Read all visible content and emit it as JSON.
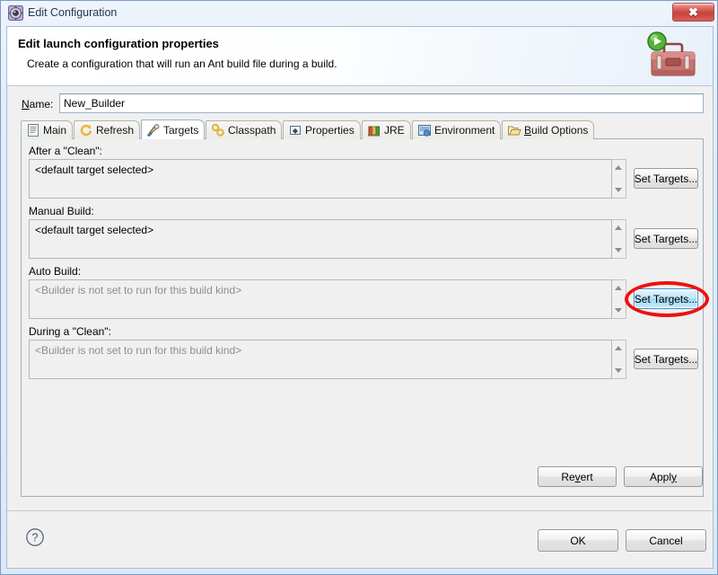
{
  "window": {
    "title": "Edit Configuration",
    "icon": "config-gear-icon",
    "close_label": "✖"
  },
  "header": {
    "title": "Edit launch configuration properties",
    "subtitle": "Create a configuration that will run an Ant build file during a build.",
    "art_icon": "toolbox-with-run-badge-icon"
  },
  "name_row": {
    "label_pre": "",
    "label_accel": "N",
    "label_post": "ame:",
    "value": "New_Builder",
    "placeholder": "Enter configuration name"
  },
  "tabs": [
    {
      "label": "Main",
      "icon": "document-icon",
      "active": false,
      "accel": ""
    },
    {
      "label": "Refresh",
      "icon": "refresh-icon",
      "active": false,
      "accel": ""
    },
    {
      "label": "Targets",
      "icon": "targets-icon",
      "active": true,
      "accel": ""
    },
    {
      "label": "Classpath",
      "icon": "classpath-icon",
      "active": false,
      "accel": ""
    },
    {
      "label": "Properties",
      "icon": "properties-icon",
      "active": false,
      "accel": ""
    },
    {
      "label": "JRE",
      "icon": "jre-icon",
      "active": false,
      "accel": ""
    },
    {
      "label": "Environment",
      "icon": "environment-icon",
      "active": false,
      "accel": ""
    },
    {
      "label": "Build Options",
      "icon": "folder-icon",
      "active": false,
      "accel": "B"
    }
  ],
  "targets": {
    "groups": [
      {
        "label": "After a \"Clean\":",
        "value": "<default target selected>",
        "dim": false,
        "button": "Set Targets...",
        "highlighted": false
      },
      {
        "label": "Manual Build:",
        "value": "<default target selected>",
        "dim": false,
        "button": "Set Targets...",
        "highlighted": false
      },
      {
        "label": "Auto Build:",
        "value": "<Builder is not set to run for this build kind>",
        "dim": true,
        "button": "Set Targets...",
        "highlighted": true
      },
      {
        "label": "During a \"Clean\":",
        "value": "<Builder is not set to run for this build kind>",
        "dim": true,
        "button": "Set Targets...",
        "highlighted": false
      }
    ]
  },
  "apply_bar": {
    "revert_pre": "Re",
    "revert_accel": "v",
    "revert_post": "ert",
    "apply_pre": "Appl",
    "apply_accel": "y",
    "apply_post": ""
  },
  "footer": {
    "help_icon": "help-question-icon",
    "ok": "OK",
    "cancel": "Cancel"
  },
  "colors": {
    "accent": "#3c93c2",
    "annotation": "#ee1111",
    "dialog_bg": "#f0f0f0",
    "close_red": "#c8423c",
    "dim_text": "#8e8e8e"
  }
}
